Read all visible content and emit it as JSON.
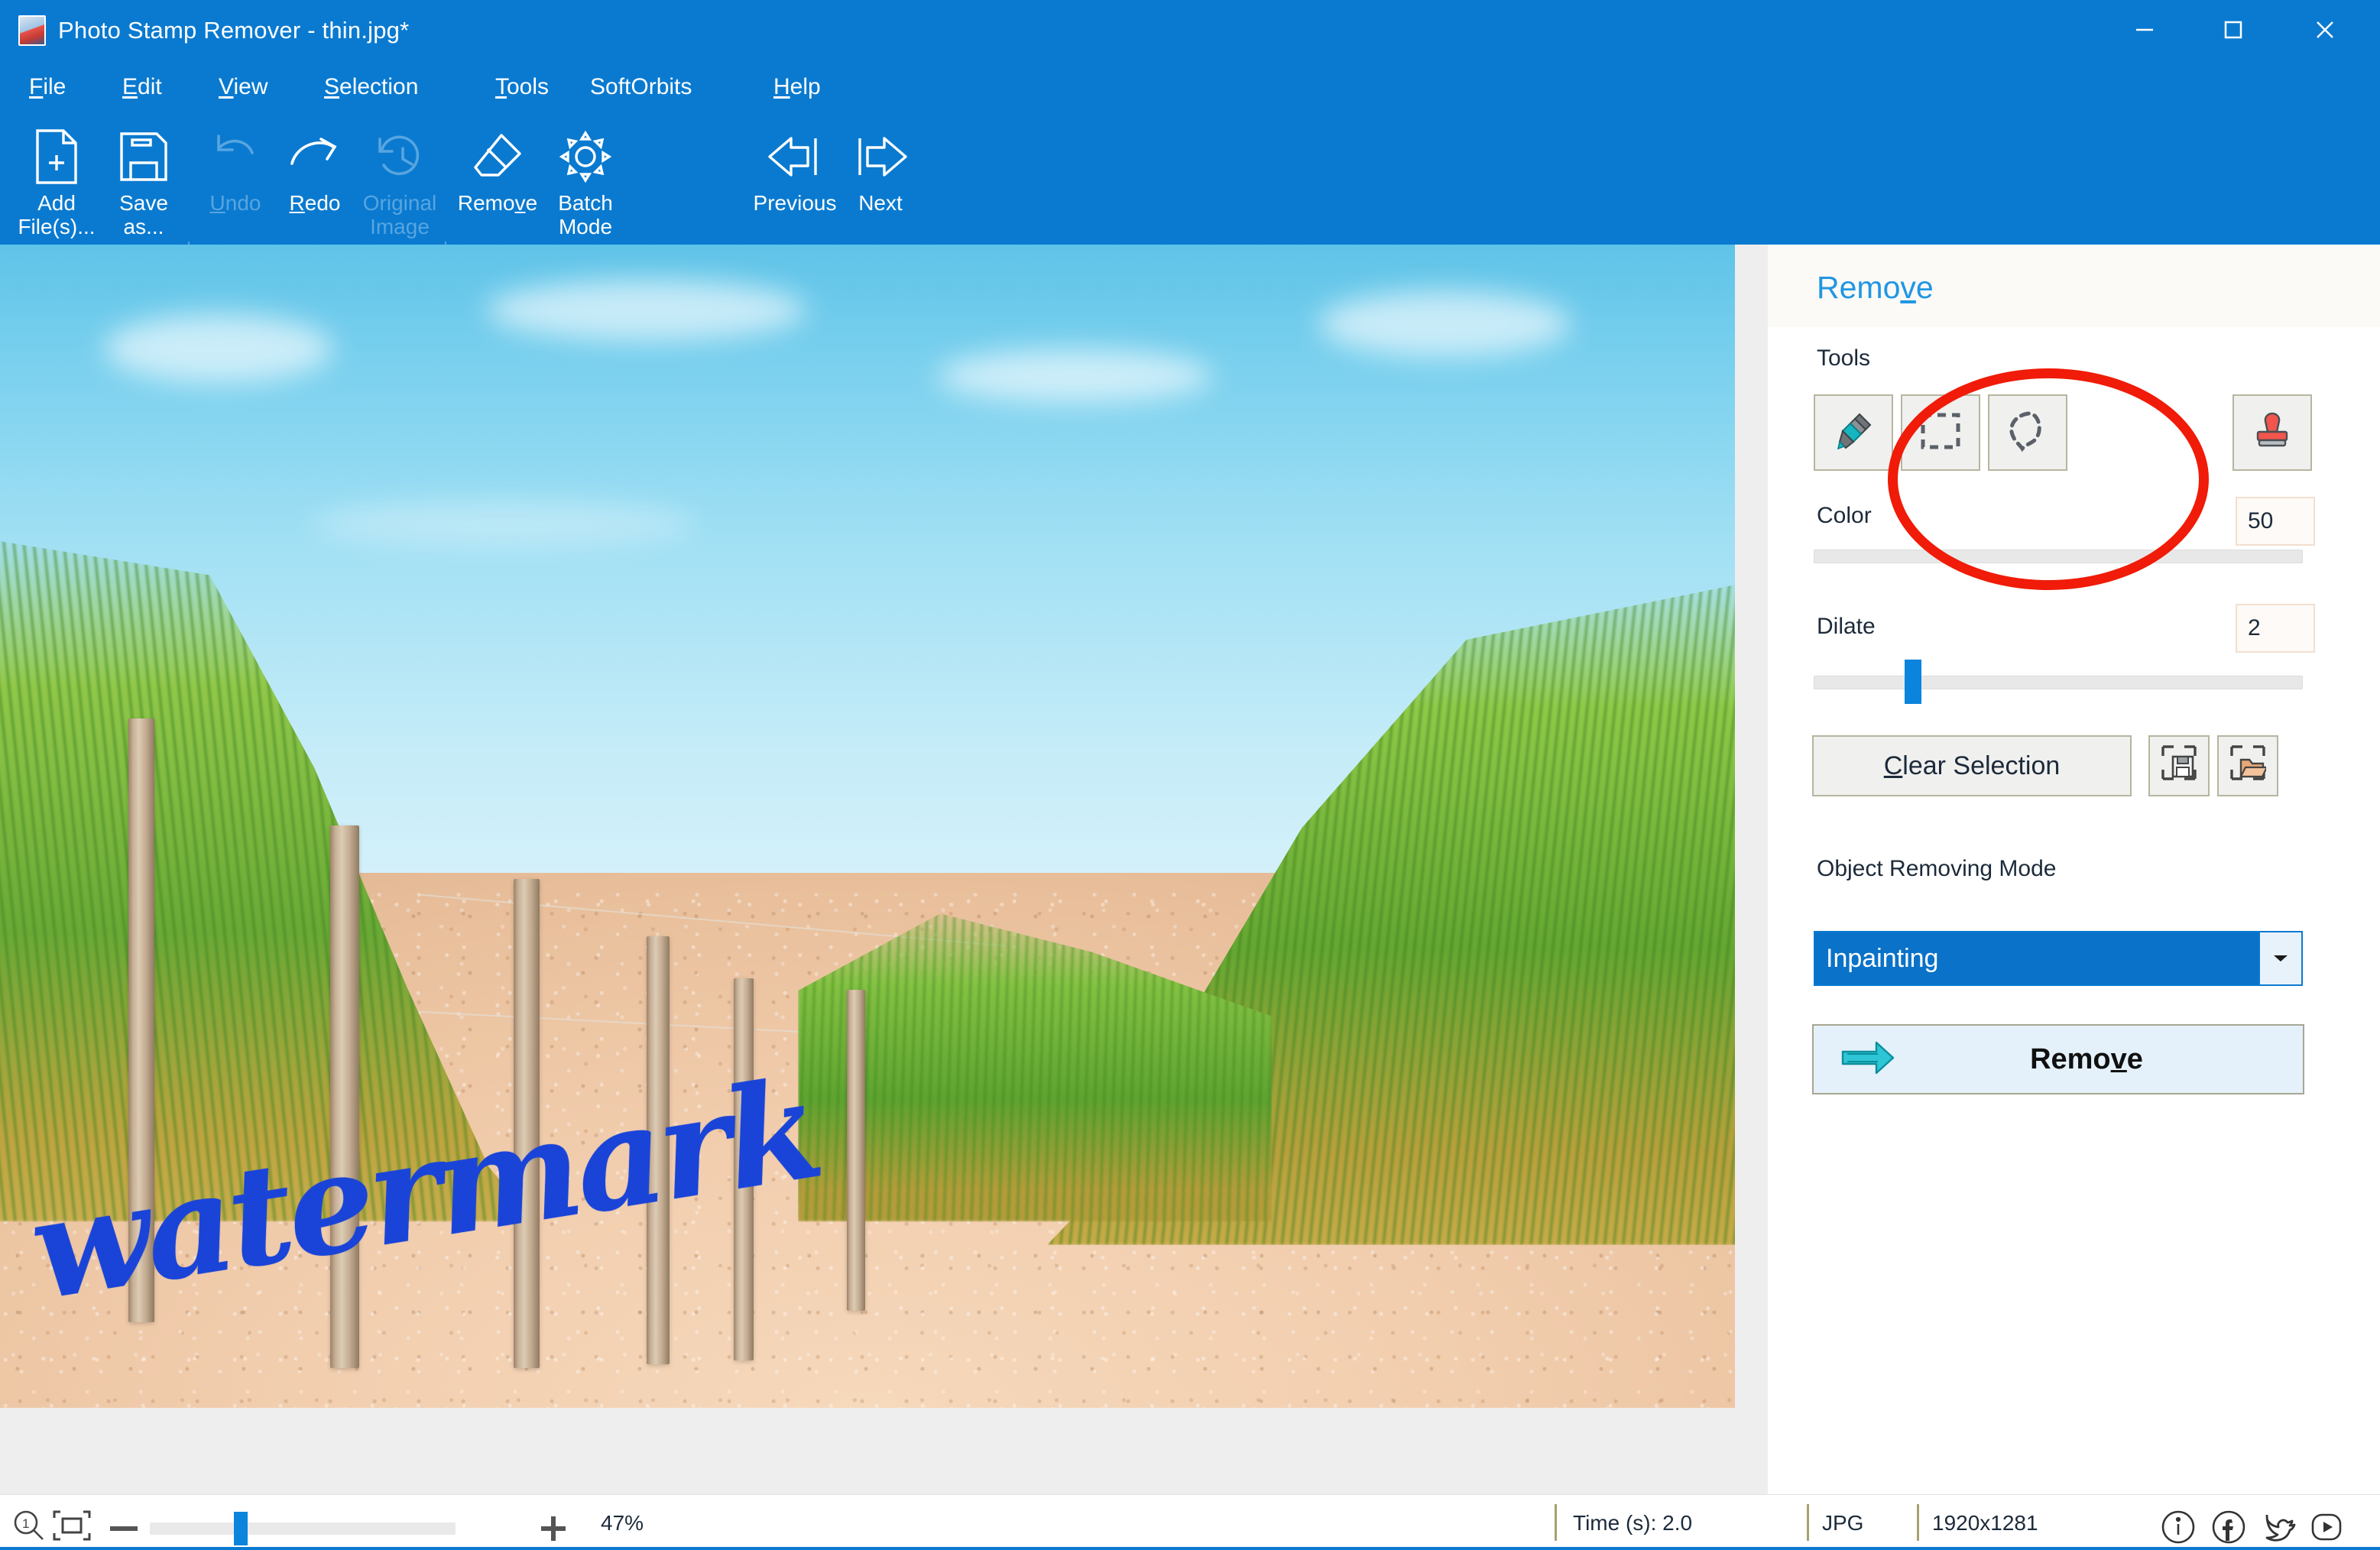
{
  "window": {
    "title": "Photo Stamp Remover - thin.jpg*",
    "app_icon": "app-photo-icon",
    "controls": {
      "minimize": "minimize-icon",
      "maximize": "maximize-icon",
      "close": "close-icon"
    },
    "titlebar_color": "#0a7ad0"
  },
  "menu": {
    "items": [
      {
        "label": "File",
        "accel": "F"
      },
      {
        "label": "Edit",
        "accel": "E"
      },
      {
        "label": "View",
        "accel": "V"
      },
      {
        "label": "Selection",
        "accel": "S"
      },
      {
        "label": "Tools",
        "accel": "T"
      },
      {
        "label": "SoftOrbits",
        "accel": ""
      },
      {
        "label": "Help",
        "accel": "H"
      }
    ]
  },
  "toolbar": {
    "buttons": [
      {
        "id": "add-files",
        "label": "Add\nFile(s)...",
        "icon": "document-plus-icon",
        "enabled": true
      },
      {
        "id": "save-as",
        "label": "Save\nas...",
        "icon": "floppy-disk-icon",
        "enabled": true
      },
      {
        "id": "undo",
        "label": "Undo",
        "icon": "undo-arrow-icon",
        "enabled": false
      },
      {
        "id": "redo",
        "label": "Redo",
        "icon": "redo-arrow-icon",
        "enabled": true
      },
      {
        "id": "original-image",
        "label": "Original\nImage",
        "icon": "history-clock-icon",
        "enabled": false
      },
      {
        "id": "remove",
        "label": "Remove",
        "icon": "eraser-icon",
        "enabled": true
      },
      {
        "id": "batch-mode",
        "label": "Batch\nMode",
        "icon": "gear-icon",
        "enabled": true
      },
      {
        "id": "previous",
        "label": "Previous",
        "icon": "arrow-left-icon",
        "enabled": true
      },
      {
        "id": "next",
        "label": "Next",
        "icon": "arrow-right-icon",
        "enabled": true
      }
    ]
  },
  "canvas": {
    "image_watermark_text": "watermark",
    "watermark_color": "#1a44d8",
    "background_color": "#eeeeee"
  },
  "panel": {
    "header": "Remove",
    "tools_label": "Tools",
    "tools": [
      {
        "id": "marker",
        "icon": "marker-pen-icon",
        "selected": false
      },
      {
        "id": "rectangle",
        "icon": "rectangle-selection-icon",
        "selected": false
      },
      {
        "id": "lasso",
        "icon": "lasso-selection-icon",
        "selected": false
      },
      {
        "id": "stamp",
        "icon": "rubber-stamp-icon",
        "selected": false
      }
    ],
    "color_label": "Color",
    "color_value": "50",
    "dilate_label": "Dilate",
    "dilate_value": "2",
    "clear_selection_label": "Clear Selection",
    "clear_selection_accel": "C",
    "save_selection_icon": "save-selection-icon",
    "load_selection_icon": "open-selection-icon",
    "object_removing_mode_label": "Object Removing Mode",
    "object_removing_mode_value": "Inpainting",
    "remove_button_label": "Remove",
    "remove_button_accel": "v",
    "remove_button_icon": "arrow-right-thick-icon",
    "annotation": {
      "shape": "red-ellipse",
      "color": "#f01b08"
    }
  },
  "statusbar": {
    "zoom_one_to_one_icon": "zoom-actual-size-icon",
    "fit_to_window_icon": "fit-to-window-icon",
    "zoom_out_icon": "minus-icon",
    "zoom_in_icon": "plus-icon",
    "zoom_level": "47%",
    "time_label": "Time (s): 2.0",
    "format": "JPG",
    "dimensions": "1920x1281",
    "social": [
      {
        "id": "info",
        "icon": "info-circle-icon"
      },
      {
        "id": "facebook",
        "icon": "facebook-icon"
      },
      {
        "id": "twitter",
        "icon": "twitter-bird-icon"
      },
      {
        "id": "youtube",
        "icon": "youtube-play-icon"
      }
    ]
  }
}
